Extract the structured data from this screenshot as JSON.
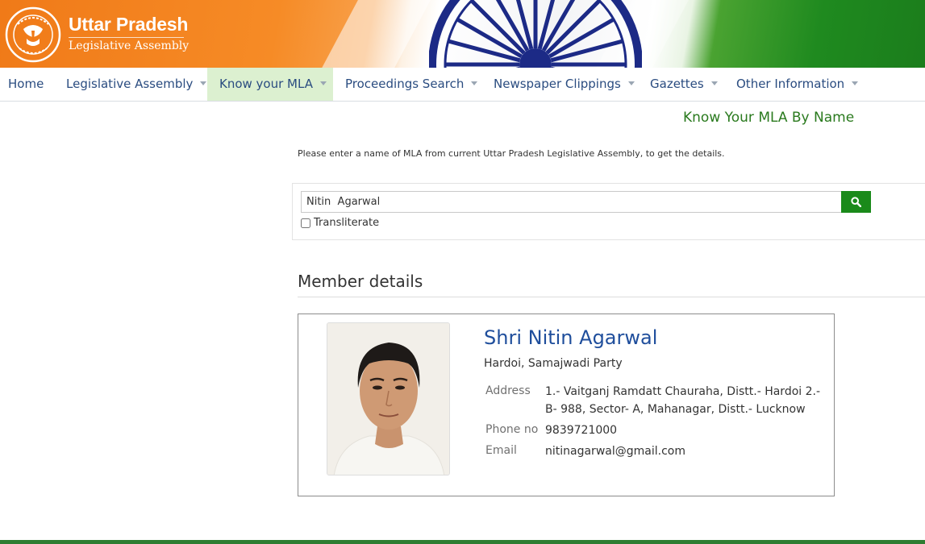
{
  "header": {
    "title": "Uttar Pradesh",
    "subtitle": "Legislative Assembly",
    "colors": {
      "saffron": "#f07a18",
      "green": "#1b7d1c",
      "chakra": "#1c2a86"
    }
  },
  "nav": {
    "items": [
      {
        "label": "Home",
        "has_dropdown": false,
        "active": false
      },
      {
        "label": "Legislative Assembly",
        "has_dropdown": true,
        "active": false
      },
      {
        "label": "Know your MLA",
        "has_dropdown": true,
        "active": true
      },
      {
        "label": "Proceedings Search",
        "has_dropdown": true,
        "active": false
      },
      {
        "label": "Newspaper Clippings",
        "has_dropdown": true,
        "active": false
      },
      {
        "label": "Gazettes",
        "has_dropdown": true,
        "active": false
      },
      {
        "label": "Other Information",
        "has_dropdown": true,
        "active": false
      }
    ]
  },
  "page": {
    "heading": "Know Your MLA By Name",
    "instruction": "Please enter a name of MLA from current Uttar Pradesh Legislative Assembly, to get the details."
  },
  "search": {
    "value": "Nitin  Agarwal",
    "button_icon": "search-icon",
    "transliterate_label": "Transliterate",
    "transliterate_checked": false
  },
  "member": {
    "section_title": "Member details",
    "name": "Shri Nitin Agarwal",
    "constituency_party": "Hardoi, Samajwadi Party",
    "address_label": "Address",
    "address": "1.- Vaitganj Ramdatt Chauraha, Distt.- Hardoi 2.- B- 988, Sector- A, Mahanagar, Distt.- Lucknow",
    "phone_label": "Phone no",
    "phone": "9839721000",
    "email_label": "Email",
    "email": "nitinagarwal@gmail.com"
  }
}
